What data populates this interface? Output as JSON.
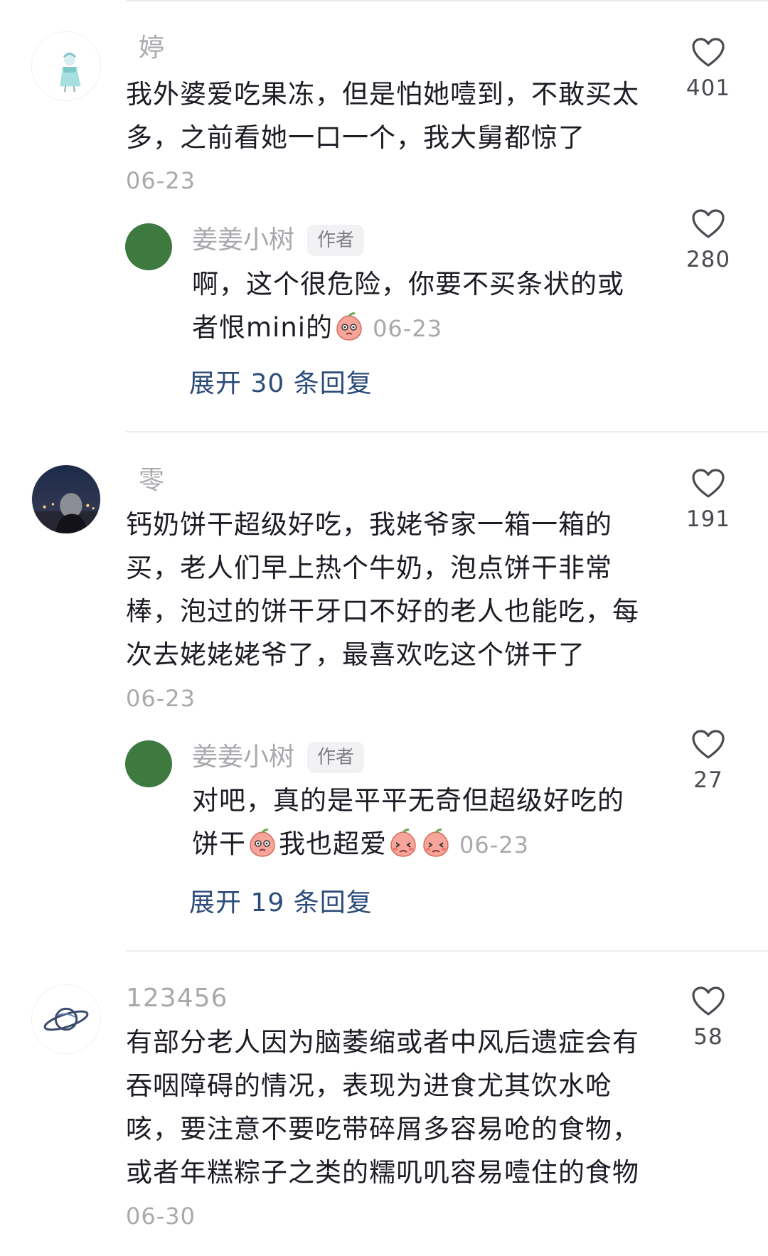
{
  "comments": [
    {
      "user": "婷",
      "text": "我外婆爱吃果冻，但是怕她噎到，不敢买太多，之前看她一口一个，我大舅都惊了",
      "text_line1": "我外婆爱吃果冻，但是怕她噎到，不敢买太",
      "text_line2": "多，之前看她一口一个，我大舅都惊了",
      "date": "06-23",
      "likes": "401",
      "reply": {
        "user": "姜姜小树",
        "badge": "作者",
        "text_line1": "啊，这个很危险，你要不买条状的或",
        "text_line2": "者恨mini的",
        "emoji": "peach-thinking-emoji",
        "date": "06-23",
        "likes": "280"
      },
      "expand_label": "展开 30 条回复"
    },
    {
      "user": "零",
      "text_line1": "钙奶饼干超级好吃，我姥爷家一箱一箱的",
      "text_line2": "买，老人们早上热个牛奶，泡点饼干非常",
      "text_line3": "棒，泡过的饼干牙口不好的老人也能吃，每",
      "text_line4": "次去姥姥姥爷了，最喜欢吃这个饼干了",
      "date": "06-23",
      "likes": "191",
      "reply": {
        "user": "姜姜小树",
        "badge": "作者",
        "text_line1": "对吧，真的是平平无奇但超级好吃的",
        "text_part_a": "饼干",
        "text_part_b": "我也超爱",
        "emojis": [
          "peach-thinking-emoji",
          "peach-shy-emoji",
          "peach-shy-emoji"
        ],
        "date": "06-23",
        "likes": "27"
      },
      "expand_label": "展开 19 条回复"
    },
    {
      "user": "123456",
      "text_line1": "有部分老人因为脑萎缩或者中风后遗症会有",
      "text_line2": "吞咽障碍的情况，表现为进食尤其饮水呛",
      "text_line3": "咳，要注意不要吃带碎屑多容易呛的食物，",
      "text_line4": "或者年糕粽子之类的糯叽叽容易噎住的食物",
      "date": "06-30",
      "likes": "58"
    }
  ],
  "colors": {
    "link": "#2b4b79",
    "muted": "#a8a9ad",
    "text": "#1c1d24",
    "reply_avatar": "#3e7a3f"
  }
}
